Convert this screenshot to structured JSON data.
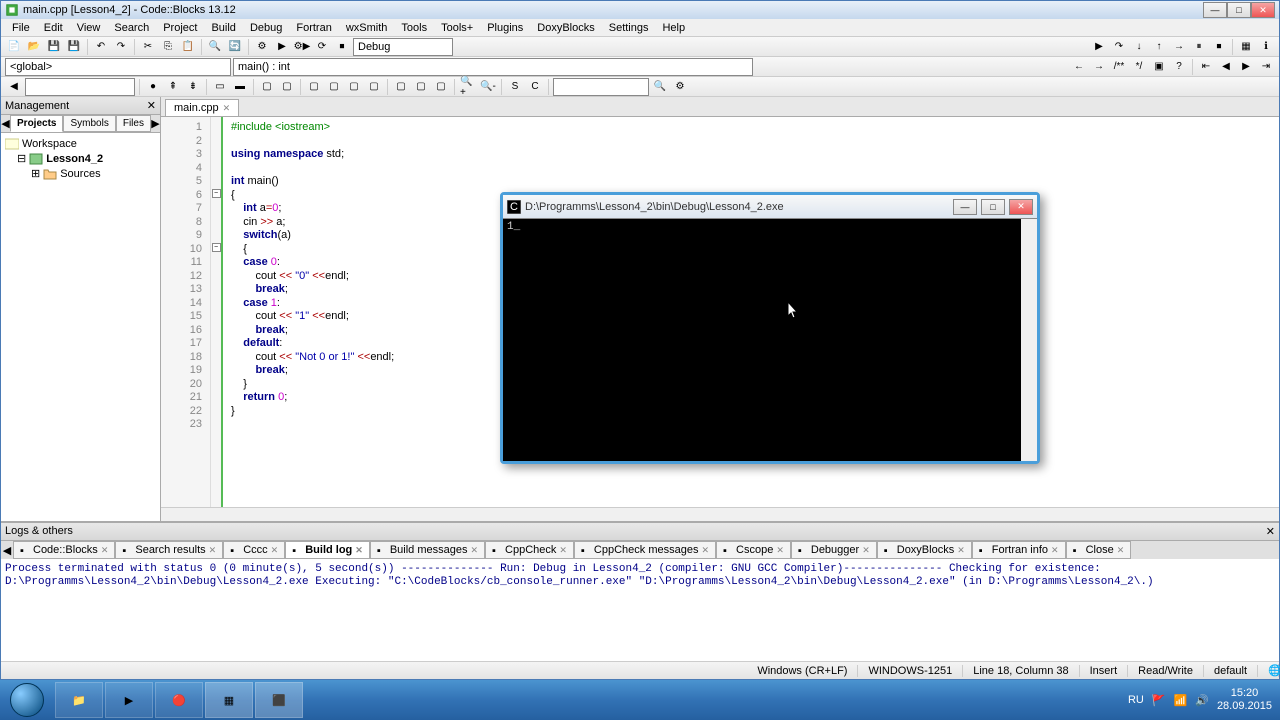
{
  "titlebar": {
    "title": "main.cpp [Lesson4_2] - Code::Blocks 13.12"
  },
  "menu": [
    "File",
    "Edit",
    "View",
    "Search",
    "Project",
    "Build",
    "Debug",
    "Fortran",
    "wxSmith",
    "Tools",
    "Tools+",
    "Plugins",
    "DoxyBlocks",
    "Settings",
    "Help"
  ],
  "combo1": "<global>",
  "combo2": "main() : int",
  "target_combo": "Debug",
  "management": {
    "title": "Management",
    "tabs": [
      "Projects",
      "Symbols",
      "Files"
    ],
    "workspace": "Workspace",
    "project": "Lesson4_2",
    "sources": "Sources"
  },
  "editor": {
    "tab": "main.cpp",
    "lines": [
      {
        "n": 1,
        "tokens": [
          {
            "t": "#include ",
            "c": "pp"
          },
          {
            "t": "<iostream>",
            "c": "pp"
          }
        ]
      },
      {
        "n": 2,
        "tokens": []
      },
      {
        "n": 3,
        "tokens": [
          {
            "t": "using namespace ",
            "c": "kw"
          },
          {
            "t": "std",
            "c": ""
          },
          {
            "t": ";",
            "c": ""
          }
        ]
      },
      {
        "n": 4,
        "tokens": []
      },
      {
        "n": 5,
        "tokens": [
          {
            "t": "int ",
            "c": "kw"
          },
          {
            "t": "main",
            "c": ""
          },
          {
            "t": "()",
            "c": ""
          }
        ]
      },
      {
        "n": 6,
        "tokens": [
          {
            "t": "{",
            "c": ""
          }
        ]
      },
      {
        "n": 7,
        "tokens": [
          {
            "t": "    ",
            "c": ""
          },
          {
            "t": "int ",
            "c": "kw"
          },
          {
            "t": "a",
            "c": ""
          },
          {
            "t": "=",
            "c": "op"
          },
          {
            "t": "0",
            "c": "num"
          },
          {
            "t": ";",
            "c": ""
          }
        ]
      },
      {
        "n": 8,
        "tokens": [
          {
            "t": "    cin ",
            "c": ""
          },
          {
            "t": ">>",
            "c": "op"
          },
          {
            "t": " a",
            "c": ""
          },
          {
            "t": ";",
            "c": ""
          }
        ]
      },
      {
        "n": 9,
        "tokens": [
          {
            "t": "    ",
            "c": ""
          },
          {
            "t": "switch",
            "c": "kw"
          },
          {
            "t": "(",
            "c": ""
          },
          {
            "t": "a",
            "c": ""
          },
          {
            "t": ")",
            "c": ""
          }
        ]
      },
      {
        "n": 10,
        "tokens": [
          {
            "t": "    {",
            "c": ""
          }
        ]
      },
      {
        "n": 11,
        "tokens": [
          {
            "t": "    ",
            "c": ""
          },
          {
            "t": "case ",
            "c": "kw"
          },
          {
            "t": "0",
            "c": "num"
          },
          {
            "t": ":",
            "c": ""
          }
        ]
      },
      {
        "n": 12,
        "tokens": [
          {
            "t": "        cout ",
            "c": ""
          },
          {
            "t": "<<",
            "c": "op"
          },
          {
            "t": " ",
            "c": ""
          },
          {
            "t": "\"0\"",
            "c": "str"
          },
          {
            "t": " ",
            "c": ""
          },
          {
            "t": "<<",
            "c": "op"
          },
          {
            "t": "endl",
            "c": ""
          },
          {
            "t": ";",
            "c": ""
          }
        ]
      },
      {
        "n": 13,
        "tokens": [
          {
            "t": "        ",
            "c": ""
          },
          {
            "t": "break",
            "c": "kw"
          },
          {
            "t": ";",
            "c": ""
          }
        ]
      },
      {
        "n": 14,
        "tokens": [
          {
            "t": "    ",
            "c": ""
          },
          {
            "t": "case ",
            "c": "kw"
          },
          {
            "t": "1",
            "c": "num"
          },
          {
            "t": ":",
            "c": ""
          }
        ]
      },
      {
        "n": 15,
        "tokens": [
          {
            "t": "        cout ",
            "c": ""
          },
          {
            "t": "<<",
            "c": "op"
          },
          {
            "t": " ",
            "c": ""
          },
          {
            "t": "\"1\"",
            "c": "str"
          },
          {
            "t": " ",
            "c": ""
          },
          {
            "t": "<<",
            "c": "op"
          },
          {
            "t": "endl",
            "c": ""
          },
          {
            "t": ";",
            "c": ""
          }
        ]
      },
      {
        "n": 16,
        "tokens": [
          {
            "t": "        ",
            "c": ""
          },
          {
            "t": "break",
            "c": "kw"
          },
          {
            "t": ";",
            "c": ""
          }
        ]
      },
      {
        "n": 17,
        "tokens": [
          {
            "t": "    ",
            "c": ""
          },
          {
            "t": "default",
            "c": "kw"
          },
          {
            "t": ":",
            "c": ""
          }
        ]
      },
      {
        "n": 18,
        "tokens": [
          {
            "t": "        cout ",
            "c": ""
          },
          {
            "t": "<<",
            "c": "op"
          },
          {
            "t": " ",
            "c": ""
          },
          {
            "t": "\"Not 0 or 1!\"",
            "c": "str"
          },
          {
            "t": " ",
            "c": ""
          },
          {
            "t": "<<",
            "c": "op"
          },
          {
            "t": "endl",
            "c": ""
          },
          {
            "t": ";",
            "c": ""
          }
        ]
      },
      {
        "n": 19,
        "tokens": [
          {
            "t": "        ",
            "c": ""
          },
          {
            "t": "break",
            "c": "kw"
          },
          {
            "t": ";",
            "c": ""
          }
        ]
      },
      {
        "n": 20,
        "tokens": [
          {
            "t": "    }",
            "c": ""
          }
        ]
      },
      {
        "n": 21,
        "tokens": [
          {
            "t": "    ",
            "c": ""
          },
          {
            "t": "return ",
            "c": "kw"
          },
          {
            "t": "0",
            "c": "num"
          },
          {
            "t": ";",
            "c": ""
          }
        ]
      },
      {
        "n": 22,
        "tokens": [
          {
            "t": "}",
            "c": ""
          }
        ]
      },
      {
        "n": 23,
        "tokens": []
      }
    ]
  },
  "logs": {
    "title": "Logs & others",
    "tabs": [
      "Code::Blocks",
      "Search results",
      "Cccc",
      "Build log",
      "Build messages",
      "CppCheck",
      "CppCheck messages",
      "Cscope",
      "Debugger",
      "DoxyBlocks",
      "Fortran info",
      "Close"
    ],
    "active_tab": 3,
    "content": "Process terminated with status 0 (0 minute(s), 5 second(s))\n\n\n-------------- Run: Debug in Lesson4_2 (compiler: GNU GCC Compiler)---------------\n\nChecking for existence: D:\\Programms\\Lesson4_2\\bin\\Debug\\Lesson4_2.exe\nExecuting: \"C:\\CodeBlocks/cb_console_runner.exe\" \"D:\\Programms\\Lesson4_2\\bin\\Debug\\Lesson4_2.exe\"  (in D:\\Programms\\Lesson4_2\\.)"
  },
  "status": {
    "eol": "Windows (CR+LF)",
    "encoding": "WINDOWS-1251",
    "pos": "Line 18, Column 38",
    "ins": "Insert",
    "rw": "Read/Write",
    "profile": "default"
  },
  "console": {
    "title": "D:\\Programms\\Lesson4_2\\bin\\Debug\\Lesson4_2.exe",
    "body": "1_"
  },
  "tray": {
    "lang": "RU",
    "time": "15:20",
    "date": "28.09.2015"
  }
}
